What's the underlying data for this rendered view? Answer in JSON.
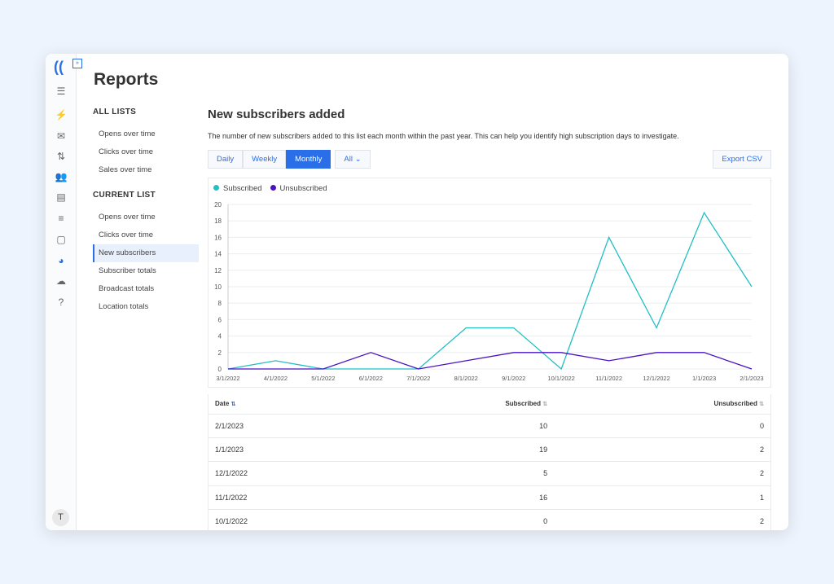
{
  "page": {
    "title": "Reports"
  },
  "nav": {
    "sections": [
      {
        "title": "ALL LISTS",
        "items": [
          "Opens over time",
          "Clicks over time",
          "Sales over time"
        ]
      },
      {
        "title": "CURRENT LIST",
        "items": [
          "Opens over time",
          "Clicks over time",
          "New subscribers",
          "Subscriber totals",
          "Broadcast totals",
          "Location totals"
        ]
      }
    ],
    "active": "New subscribers"
  },
  "rail": {
    "icons": [
      "checklist-icon",
      "automation-icon",
      "broadcast-icon",
      "sequence-icon",
      "subscribers-icon",
      "landing-page-icon",
      "settings-sliders-icon",
      "forms-icon",
      "reports-icon",
      "integrations-icon",
      "help-icon"
    ],
    "avatar": "T"
  },
  "main": {
    "title": "New subscribers added",
    "description": "The number of new subscribers added to this list each month within the past year. This can help you identify high subscription days to investigate.",
    "tabs": [
      "Daily",
      "Weekly",
      "Monthly"
    ],
    "active_tab": "Monthly",
    "filter": "All",
    "export": "Export CSV"
  },
  "colors": {
    "subscribed": "#22bfc4",
    "unsubscribed": "#4b12c2",
    "accent": "#2a6ee8"
  },
  "chart_data": {
    "type": "line",
    "x": [
      "3/1/2022",
      "4/1/2022",
      "5/1/2022",
      "6/1/2022",
      "7/1/2022",
      "8/1/2022",
      "9/1/2022",
      "10/1/2022",
      "11/1/2022",
      "12/1/2022",
      "1/1/2023",
      "2/1/2023"
    ],
    "series": [
      {
        "name": "Subscribed",
        "values": [
          0,
          1,
          0,
          0,
          0,
          5,
          5,
          0,
          16,
          5,
          19,
          10
        ]
      },
      {
        "name": "Unsubscribed",
        "values": [
          0,
          0,
          0,
          2,
          0,
          1,
          2,
          2,
          1,
          2,
          2,
          0
        ]
      }
    ],
    "yticks": [
      0,
      2,
      4,
      6,
      8,
      10,
      12,
      14,
      16,
      18,
      20
    ],
    "ylim": [
      0,
      20
    ],
    "grid": true,
    "legend": "top-left"
  },
  "table": {
    "headers": [
      "Date",
      "Subscribed",
      "Unsubscribed"
    ],
    "rows": [
      [
        "2/1/2023",
        "10",
        "0"
      ],
      [
        "1/1/2023",
        "19",
        "2"
      ],
      [
        "12/1/2022",
        "5",
        "2"
      ],
      [
        "11/1/2022",
        "16",
        "1"
      ],
      [
        "10/1/2022",
        "0",
        "2"
      ]
    ]
  }
}
